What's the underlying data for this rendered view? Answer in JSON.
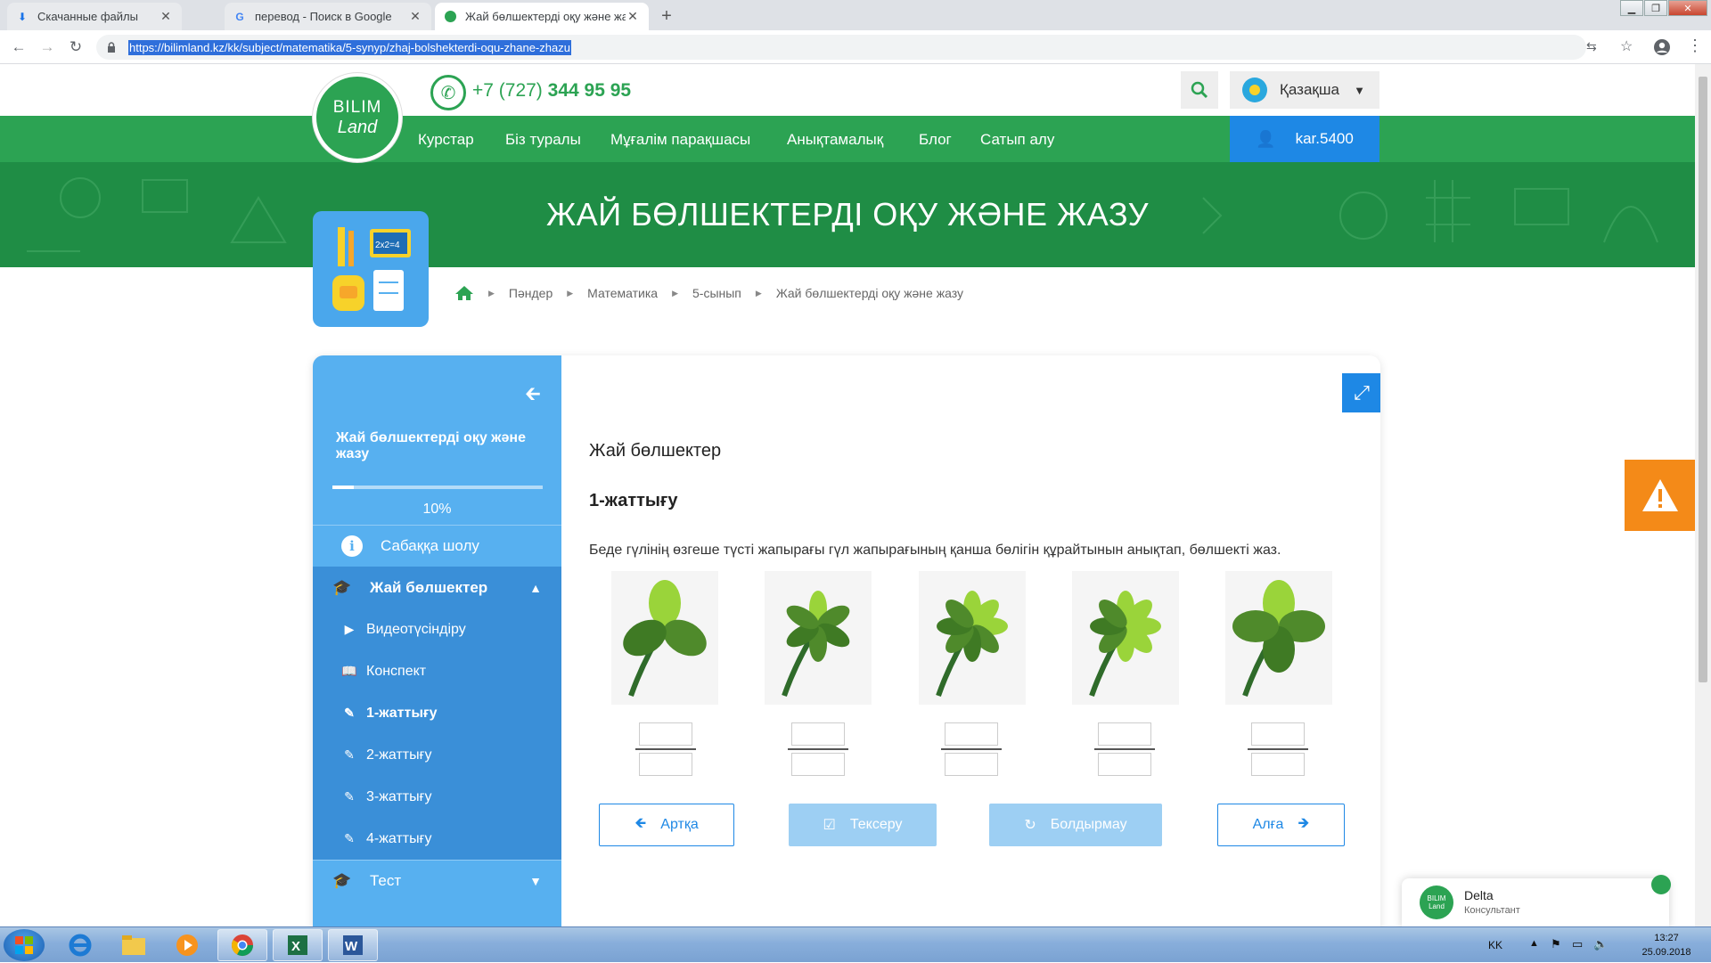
{
  "browser": {
    "tabs": [
      {
        "title": "Скачанные файлы",
        "icon": "download-icon"
      },
      {
        "title": "перевод - Поиск в Google",
        "icon": "google-icon"
      },
      {
        "title": "Жай бөлшектерді оқу және жазу",
        "icon": "bilimland-icon"
      }
    ],
    "url": "https://bilimland.kz/kk/subject/matematika/5-synyp/zhaj-bolshekterdi-oqu-zhane-zhazu"
  },
  "header": {
    "logo_line1": "BILIM",
    "logo_line2": "Land",
    "phone_prefix": "+7 (727)",
    "phone_number": "344 95 95",
    "language": "Қазақша",
    "brand_color": "#2ca353",
    "accent_color": "#1e88e5"
  },
  "nav": {
    "items": [
      "Курстар",
      "Біз туралы",
      "Мұғалім парақшасы",
      "Анықтамалық",
      "Блог",
      "Сатып алу"
    ],
    "user": "kar.5400"
  },
  "banner": {
    "title": "ЖАЙ БӨЛШЕКТЕРДІ ОҚУ ЖӘНЕ ЖАЗУ"
  },
  "breadcrumb": [
    "Пәндер",
    "Математика",
    "5-сынып",
    "Жай бөлшектерді оқу және жазу"
  ],
  "sidebar": {
    "title": "Жай бөлшектерді оқу және жазу",
    "progress": 0.1,
    "progress_label": "10%",
    "overview": "Сабаққа шолу",
    "section": "Жай бөлшектер",
    "items": [
      {
        "label": "Видеотүсіндіру",
        "icon": "play-icon"
      },
      {
        "label": "Конспект",
        "icon": "book-icon"
      },
      {
        "label": "1-жаттығу",
        "icon": "edit-icon"
      },
      {
        "label": "2-жаттығу",
        "icon": "edit-icon"
      },
      {
        "label": "3-жаттығу",
        "icon": "edit-icon"
      },
      {
        "label": "4-жаттығу",
        "icon": "edit-icon"
      }
    ],
    "test": "Тест"
  },
  "main": {
    "lesson_title": "Жай бөлшектер",
    "exercise_title": "1-жаттығу",
    "instruction": "Беде гүлінің өзгеше түсті жапырағы гүл жапырағының қанша бөлігін құрайтынын анықтап, бөлшекті жаз.",
    "clovers": [
      {
        "leaves": 3,
        "highlighted": 1
      },
      {
        "leaves": 6,
        "highlighted": 1
      },
      {
        "leaves": 8,
        "highlighted": 3
      },
      {
        "leaves": 8,
        "highlighted": 5
      },
      {
        "leaves": 4,
        "highlighted": 1
      }
    ],
    "buttons": {
      "back": "Артқа",
      "check": "Тексеру",
      "reset": "Болдырмау",
      "next": "Алға"
    }
  },
  "chat": {
    "name": "Delta",
    "role": "Консультант"
  },
  "taskbar": {
    "lang": "KK",
    "time": "13:27",
    "date": "25.09.2018"
  }
}
